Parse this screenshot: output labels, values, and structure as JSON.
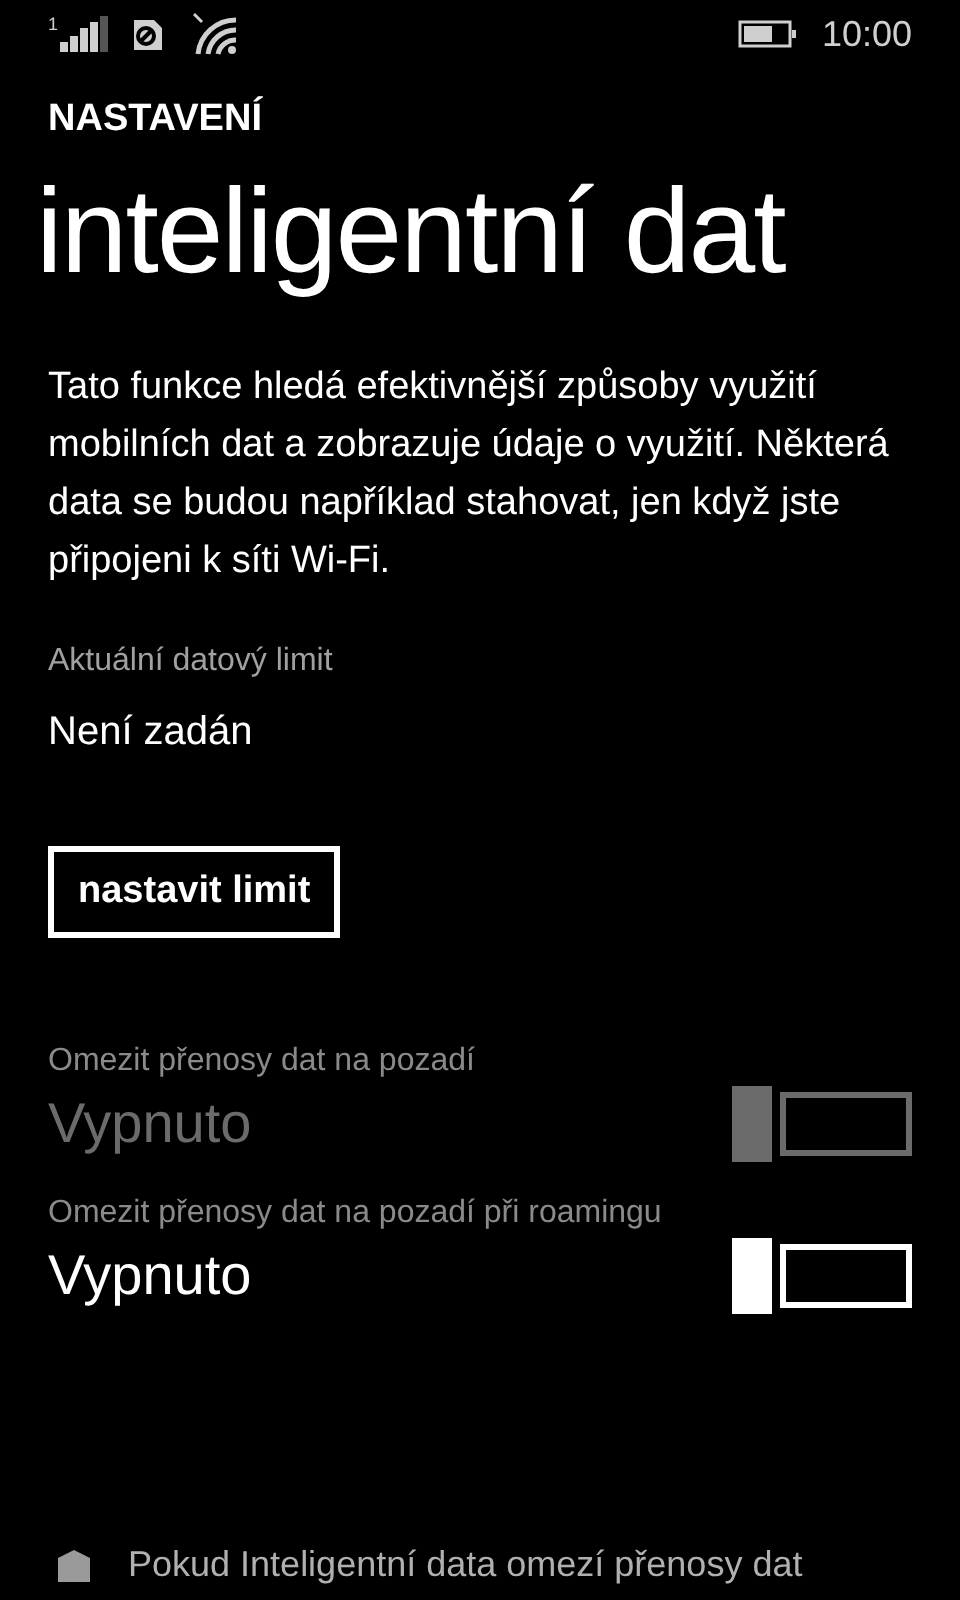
{
  "status_bar": {
    "sim_number": "1",
    "time": "10:00"
  },
  "header": {
    "app_title": "NASTAVENÍ",
    "page_title": "inteligentní dat"
  },
  "description": "Tato funkce hledá efektivnější způsoby využití mobilních dat a zobrazuje údaje o využití. Některá data se budou například stahovat, jen když jste připojeni k síti Wi-Fi.",
  "data_limit": {
    "label": "Aktuální datový limit",
    "value": "Není zadán",
    "button": "nastavit limit"
  },
  "toggles": [
    {
      "label": "Omezit přenosy dat na pozadí",
      "value": "Vypnuto",
      "on": false,
      "disabled": true
    },
    {
      "label": "Omezit přenosy dat na pozadí při roamingu",
      "value": "Vypnuto",
      "on": false,
      "disabled": false
    }
  ],
  "note": "Pokud Inteligentní data omezí přenosy dat"
}
